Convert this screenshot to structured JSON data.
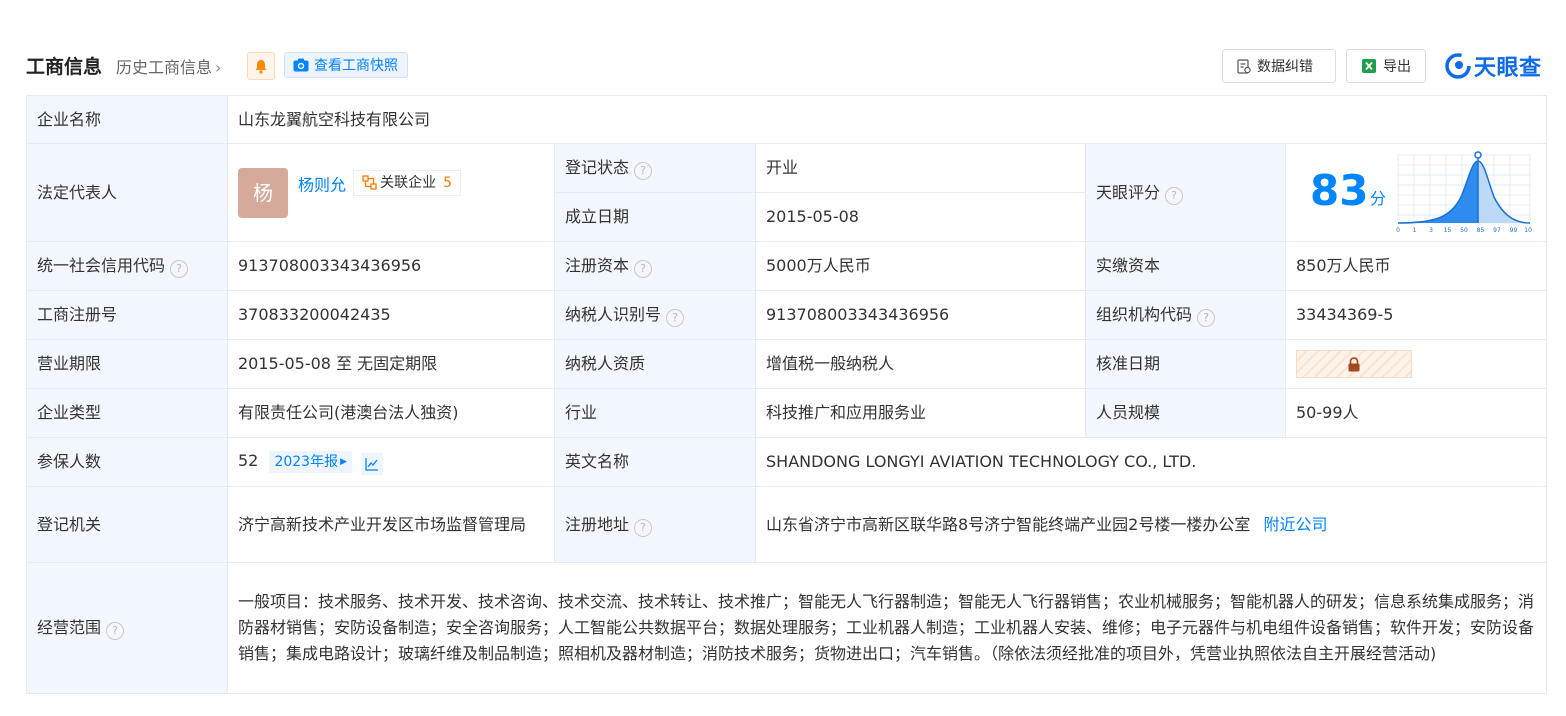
{
  "header": {
    "title": "工商信息",
    "history": "历史工商信息",
    "snapshot": "查看工商快照",
    "correction": "数据纠错",
    "export": "导出",
    "logo": "天眼查"
  },
  "colors": {
    "accent": "#0084ff",
    "status_green": "#1f9c3d",
    "label_bg": "#f2f7fd"
  },
  "rows": {
    "company_name": {
      "label": "企业名称",
      "value": "山东龙翼航空科技有限公司"
    },
    "legal_rep": {
      "label": "法定代表人",
      "avatar_char": "杨",
      "name": "杨则允",
      "related_label": "关联企业",
      "related_count": "5"
    },
    "reg_status": {
      "label": "登记状态",
      "value": "开业"
    },
    "founded": {
      "label": "成立日期",
      "value": "2015-05-08"
    },
    "score": {
      "label": "天眼评分",
      "value": "83",
      "unit": "分",
      "axis_ticks": [
        "0",
        "1",
        "3",
        "15",
        "50",
        "85",
        "97",
        "99",
        "100"
      ]
    },
    "credit_code": {
      "label": "统一社会信用代码",
      "value": "913708003343436956"
    },
    "reg_capital": {
      "label": "注册资本",
      "value": "5000万人民币"
    },
    "paid_capital": {
      "label": "实缴资本",
      "value": "850万人民币"
    },
    "reg_number": {
      "label": "工商注册号",
      "value": "370833200042435"
    },
    "taxpayer_id": {
      "label": "纳税人识别号",
      "value": "913708003343436956"
    },
    "org_code": {
      "label": "组织机构代码",
      "value": "33434369-5"
    },
    "term": {
      "label": "营业期限",
      "value": "2015-05-08 至 无固定期限"
    },
    "taxpayer_type": {
      "label": "纳税人资质",
      "value": "增值税一般纳税人"
    },
    "approval_date": {
      "label": "核准日期"
    },
    "company_type": {
      "label": "企业类型",
      "value": "有限责任公司(港澳台法人独资)"
    },
    "industry": {
      "label": "行业",
      "value": "科技推广和应用服务业"
    },
    "staff_size": {
      "label": "人员规模",
      "value": "50-99人"
    },
    "insured": {
      "label": "参保人数",
      "value": "52",
      "year_report": "2023年报"
    },
    "english_name": {
      "label": "英文名称",
      "value": "SHANDONG LONGYI AVIATION TECHNOLOGY CO., LTD."
    },
    "reg_authority": {
      "label": "登记机关",
      "value": "济宁高新技术产业开发区市场监督管理局"
    },
    "reg_address": {
      "label": "注册地址",
      "value": "山东省济宁市高新区联华路8号济宁智能终端产业园2号楼一楼办公室",
      "nearby": "附近公司"
    },
    "scope": {
      "label": "经营范围",
      "value": "一般项目：技术服务、技术开发、技术咨询、技术交流、技术转让、技术推广；智能无人飞行器制造；智能无人飞行器销售；农业机械服务；智能机器人的研发；信息系统集成服务；消防器材销售；安防设备制造；安全咨询服务；人工智能公共数据平台；数据处理服务；工业机器人制造；工业机器人安装、维修；电子元器件与机电组件设备销售；软件开发；安防设备销售；集成电路设计；玻璃纤维及制品制造；照相机及器材制造；消防技术服务；货物进出口；汽车销售。（除依法须经批准的项目外，凭营业执照依法自主开展经营活动)"
    }
  }
}
